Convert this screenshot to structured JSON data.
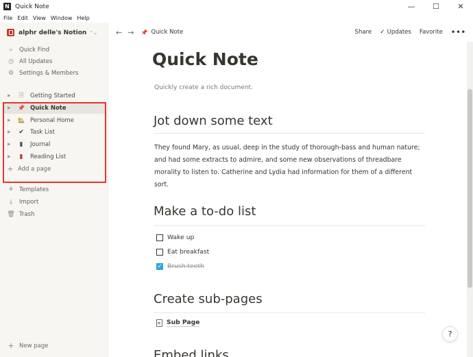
{
  "window": {
    "title": "Quick Note",
    "app_icon": "N",
    "minimize": "—",
    "maximize": "☐",
    "close": "✕"
  },
  "menu": [
    "File",
    "Edit",
    "View",
    "Window",
    "Help"
  ],
  "sidebar": {
    "workspace": "alphr delle's Notion",
    "workspace_chevron": "⌃⌄",
    "nav": [
      {
        "icon": "search-icon",
        "glyph": "⌕",
        "label": "Quick Find"
      },
      {
        "icon": "clock-icon",
        "glyph": "◷",
        "label": "All Updates"
      },
      {
        "icon": "gear-icon",
        "glyph": "⚙",
        "label": "Settings & Members"
      }
    ],
    "pages": [
      {
        "icon": "page-icon",
        "glyph": "🗎",
        "label": "Getting Started"
      },
      {
        "icon": "pushpin-icon",
        "glyph": "📌",
        "label": "Quick Note"
      },
      {
        "icon": "house-icon",
        "glyph": "🏡",
        "label": "Personal Home"
      },
      {
        "icon": "checkmark-icon",
        "glyph": "✔",
        "label": "Task List"
      },
      {
        "icon": "journal-icon",
        "glyph": "▮",
        "label": "Journal"
      },
      {
        "icon": "book-icon",
        "glyph": "▮",
        "label": "Reading List"
      }
    ],
    "add_page": "Add a page",
    "tools": [
      {
        "icon": "templates-icon",
        "glyph": "⚘",
        "label": "Templates"
      },
      {
        "icon": "import-icon",
        "glyph": "⤓",
        "label": "Import"
      },
      {
        "icon": "trash-icon",
        "glyph": "🗑",
        "label": "Trash"
      }
    ],
    "new_page": "New page"
  },
  "topbar": {
    "back": "←",
    "forward": "→",
    "breadcrumb_icon": "📌",
    "breadcrumb": "Quick Note",
    "share": "Share",
    "updates": "Updates",
    "favorite": "Favorite",
    "more": "•••"
  },
  "page": {
    "title": "Quick Note",
    "subtitle": "Quickly create a rich document.",
    "h_text": "Jot down some text",
    "paragraph": "They found Mary, as usual, deep in the study of thorough-bass and human nature; and had some extracts to admire, and some new observations of threadbare morality to listen to. Catherine and Lydia had information for them of a different sort.",
    "h_todo": "Make a to-do list",
    "todos": [
      {
        "label": "Wake up",
        "checked": false
      },
      {
        "label": "Eat breakfast",
        "checked": false
      },
      {
        "label": "Brush teeth",
        "checked": true
      }
    ],
    "h_sub": "Create sub-pages",
    "subpage": "Sub Page",
    "h_embed": "Embed links"
  },
  "help": "?",
  "colors": {
    "highlight": "#e8322d",
    "accent": "#2eaadc"
  }
}
